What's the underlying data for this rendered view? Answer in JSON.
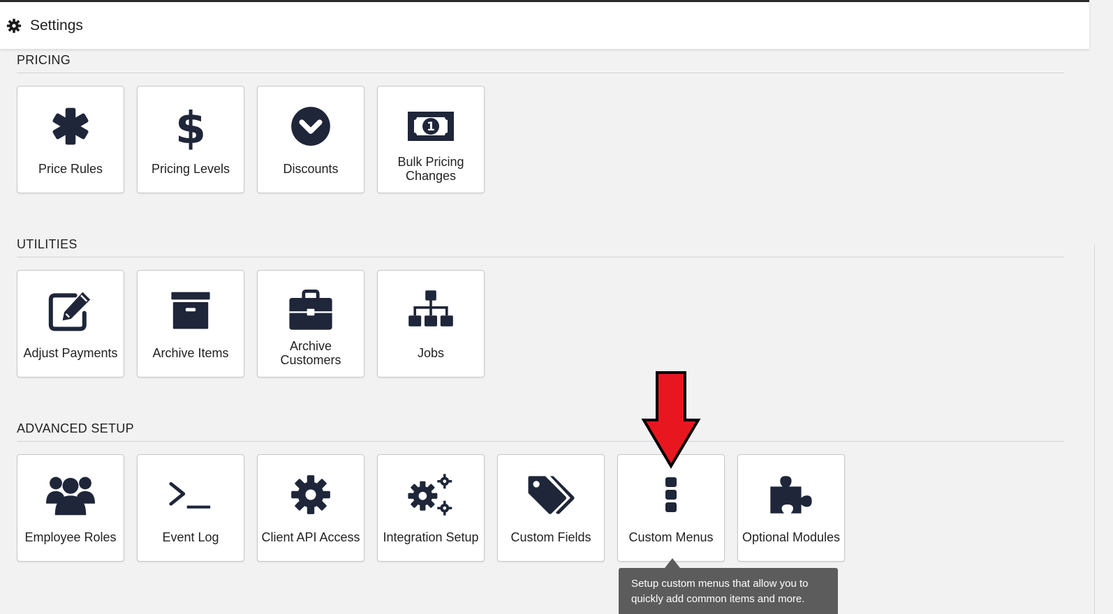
{
  "header": {
    "title": "Settings",
    "icon": "gear-icon"
  },
  "sections": {
    "pricing": {
      "title": "PRICING",
      "tiles": [
        {
          "label": "Price Rules",
          "icon": "asterisk-icon"
        },
        {
          "label": "Pricing Levels",
          "icon": "dollar-icon"
        },
        {
          "label": "Discounts",
          "icon": "chevron-circle-down-icon"
        },
        {
          "label": "Bulk Pricing Changes",
          "icon": "banknote-icon"
        }
      ]
    },
    "utilities": {
      "title": "UTILITIES",
      "tiles": [
        {
          "label": "Adjust Payments",
          "icon": "edit-icon"
        },
        {
          "label": "Archive Items",
          "icon": "archive-box-icon"
        },
        {
          "label": "Archive Customers",
          "icon": "briefcase-icon"
        },
        {
          "label": "Jobs",
          "icon": "sitemap-icon"
        }
      ]
    },
    "advanced": {
      "title": "ADVANCED SETUP",
      "tiles": [
        {
          "label": "Employee Roles",
          "icon": "users-icon"
        },
        {
          "label": "Event Log",
          "icon": "terminal-icon"
        },
        {
          "label": "Client API Access",
          "icon": "cog-icon"
        },
        {
          "label": "Integration Setup",
          "icon": "cogs-icon"
        },
        {
          "label": "Custom Fields",
          "icon": "tags-icon"
        },
        {
          "label": "Custom Menus",
          "icon": "ellipsis-vertical-icon"
        },
        {
          "label": "Optional Modules",
          "icon": "puzzle-icon"
        }
      ]
    }
  },
  "tooltip": {
    "text": "Setup custom menus that allow you to quickly add common items and more."
  },
  "colors": {
    "icon": "#1f2639",
    "annotation_arrow": "#e8171f",
    "tooltip_bg": "#5c5c5c"
  }
}
